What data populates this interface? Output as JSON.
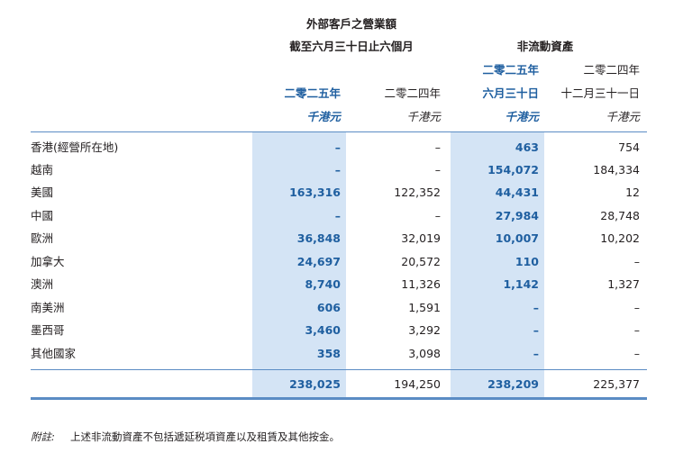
{
  "header": {
    "group_external": "外部客戶之營業額",
    "group_external_sub": "截至六月三十日止六個月",
    "group_noncurrent": "非流動資產",
    "col_2025_h1": "二零二五年",
    "col_2024_h1": "二零二四年",
    "col_2025_year": "二零二五年",
    "col_2025_date": "六月三十日",
    "col_2024_year": "二零二四年",
    "col_2024_date": "十二月三十一日",
    "unit": "千港元"
  },
  "rows": [
    {
      "region": "香港(經營所在地)",
      "rev_2025": "–",
      "rev_2024": "–",
      "nca_2025": "463",
      "nca_2024": "754"
    },
    {
      "region": "越南",
      "rev_2025": "–",
      "rev_2024": "–",
      "nca_2025": "154,072",
      "nca_2024": "184,334"
    },
    {
      "region": "美國",
      "rev_2025": "163,316",
      "rev_2024": "122,352",
      "nca_2025": "44,431",
      "nca_2024": "12"
    },
    {
      "region": "中國",
      "rev_2025": "–",
      "rev_2024": "–",
      "nca_2025": "27,984",
      "nca_2024": "28,748"
    },
    {
      "region": "歐洲",
      "rev_2025": "36,848",
      "rev_2024": "32,019",
      "nca_2025": "10,007",
      "nca_2024": "10,202"
    },
    {
      "region": "加拿大",
      "rev_2025": "24,697",
      "rev_2024": "20,572",
      "nca_2025": "110",
      "nca_2024": "–"
    },
    {
      "region": "澳洲",
      "rev_2025": "8,740",
      "rev_2024": "11,326",
      "nca_2025": "1,142",
      "nca_2024": "1,327"
    },
    {
      "region": "南美洲",
      "rev_2025": "606",
      "rev_2024": "1,591",
      "nca_2025": "–",
      "nca_2024": "–"
    },
    {
      "region": "墨西哥",
      "rev_2025": "3,460",
      "rev_2024": "3,292",
      "nca_2025": "–",
      "nca_2024": "–"
    },
    {
      "region": "其他國家",
      "rev_2025": "358",
      "rev_2024": "3,098",
      "nca_2025": "–",
      "nca_2024": "–"
    }
  ],
  "totals": {
    "rev_2025": "238,025",
    "rev_2024": "194,250",
    "nca_2025": "238,209",
    "nca_2024": "225,377"
  },
  "footnote": {
    "label": "附註:",
    "text": "上述非流動資產不包括遞延税項資產以及租賃及其他按金。"
  },
  "colors": {
    "accent": "#1f5fa0",
    "highlight": "#d4e4f5",
    "text": "#231f20"
  }
}
